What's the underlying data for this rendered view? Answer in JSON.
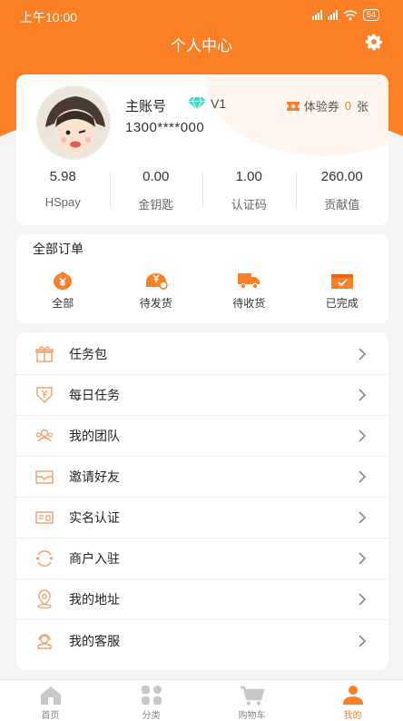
{
  "status_bar": {
    "time": "上午10:00",
    "battery": "54"
  },
  "header": {
    "title": "个人中心"
  },
  "profile": {
    "name": "主账号",
    "level": "V1",
    "ticket_label": "体验券",
    "ticket_count": "0",
    "ticket_unit": "张",
    "phone": "1300****000"
  },
  "stats": [
    {
      "value": "5.98",
      "label": "HSpay"
    },
    {
      "value": "0.00",
      "label": "金钥匙"
    },
    {
      "value": "1.00",
      "label": "认证码"
    },
    {
      "value": "260.00",
      "label": "贡献值"
    }
  ],
  "orders": {
    "title": "全部订单",
    "items": [
      {
        "label": "全部",
        "icon": "yen-bag-icon"
      },
      {
        "label": "待发货",
        "icon": "yen-package-icon"
      },
      {
        "label": "待收货",
        "icon": "truck-icon"
      },
      {
        "label": "已完成",
        "icon": "completed-box-icon"
      }
    ]
  },
  "menu": [
    {
      "label": "任务包",
      "icon": "gift-icon"
    },
    {
      "label": "每日任务",
      "icon": "shield-yen-icon"
    },
    {
      "label": "我的团队",
      "icon": "team-icon"
    },
    {
      "label": "邀请好友",
      "icon": "envelope-icon"
    },
    {
      "label": "实名认证",
      "icon": "id-card-icon"
    },
    {
      "label": "商户入驻",
      "icon": "merchant-icon"
    },
    {
      "label": "我的地址",
      "icon": "location-icon"
    },
    {
      "label": "我的客服",
      "icon": "customer-service-icon"
    }
  ],
  "tabbar": [
    {
      "label": "首页",
      "icon": "home-icon"
    },
    {
      "label": "分类",
      "icon": "category-icon"
    },
    {
      "label": "购物车",
      "icon": "cart-icon"
    },
    {
      "label": "我的",
      "icon": "user-icon"
    }
  ],
  "colors": {
    "accent": "#fb7f24",
    "background": "#f4f4f6",
    "gem": "#3fd7c8"
  }
}
